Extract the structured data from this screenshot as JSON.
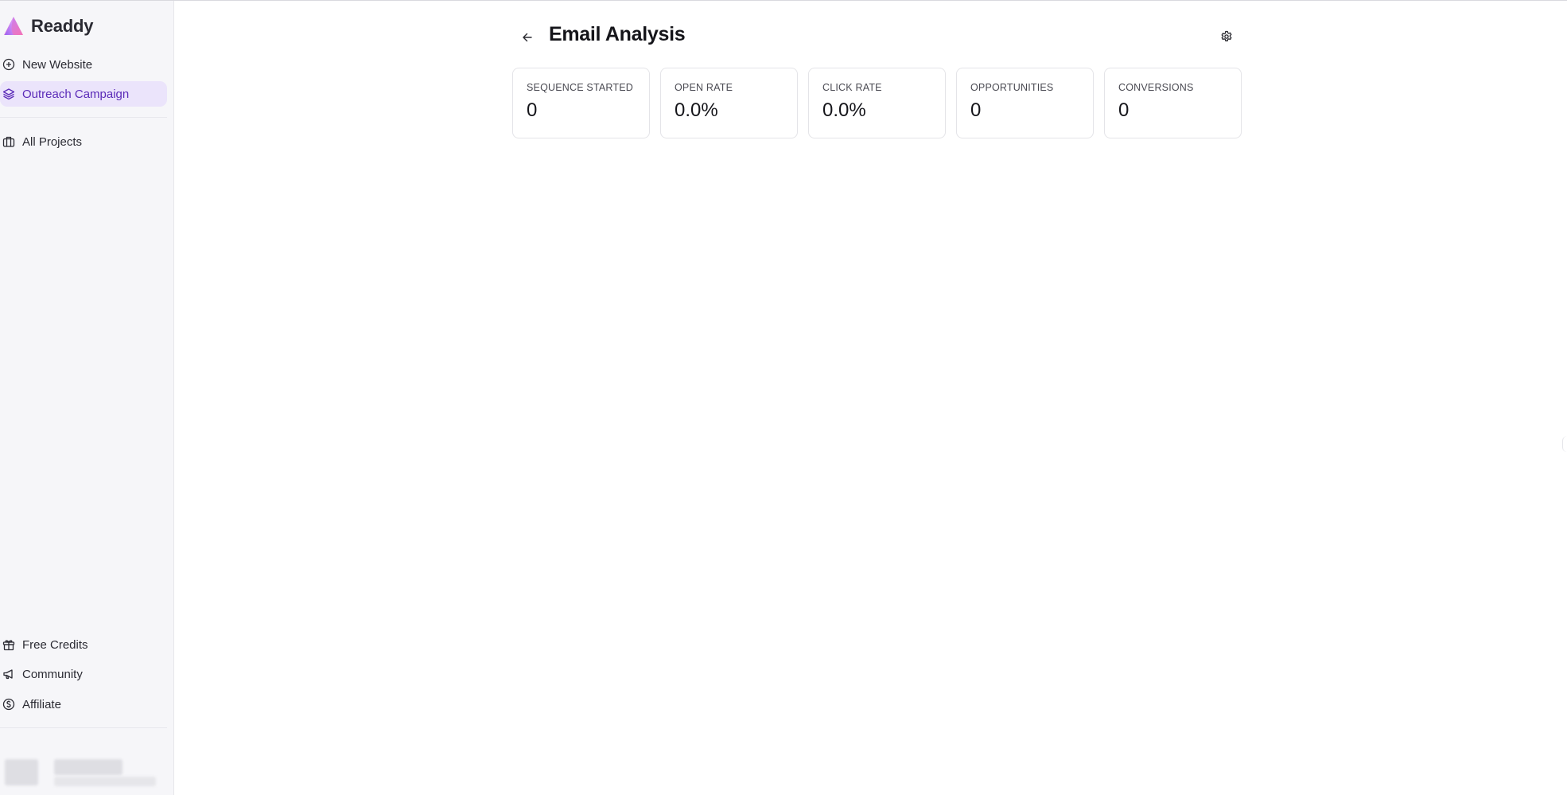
{
  "app": {
    "name": "Readdy"
  },
  "sidebar": {
    "items": [
      {
        "label": "New Website",
        "icon": "plus-circle-icon"
      },
      {
        "label": "Outreach Campaign",
        "icon": "layers-icon",
        "active": true
      },
      {
        "label": "All Projects",
        "icon": "briefcase-icon"
      }
    ],
    "bottom_items": [
      {
        "label": "Free Credits",
        "icon": "gift-icon"
      },
      {
        "label": "Community",
        "icon": "megaphone-icon"
      },
      {
        "label": "Affiliate",
        "icon": "dollar-circle-icon"
      }
    ]
  },
  "header": {
    "title": "Email Analysis",
    "back_icon": "arrow-left-icon",
    "settings_icon": "gear-icon"
  },
  "stats": [
    {
      "label": "SEQUENCE STARTED",
      "value": "0"
    },
    {
      "label": "OPEN RATE",
      "value": "0.0%"
    },
    {
      "label": "CLICK RATE",
      "value": "0.0%"
    },
    {
      "label": "OPPORTUNITIES",
      "value": "0"
    },
    {
      "label": "CONVERSIONS",
      "value": "0"
    }
  ],
  "colors": {
    "accent": "#5b2bb8",
    "active_bg": "#ebe4fb",
    "sidebar_bg": "#f6f6f9"
  }
}
